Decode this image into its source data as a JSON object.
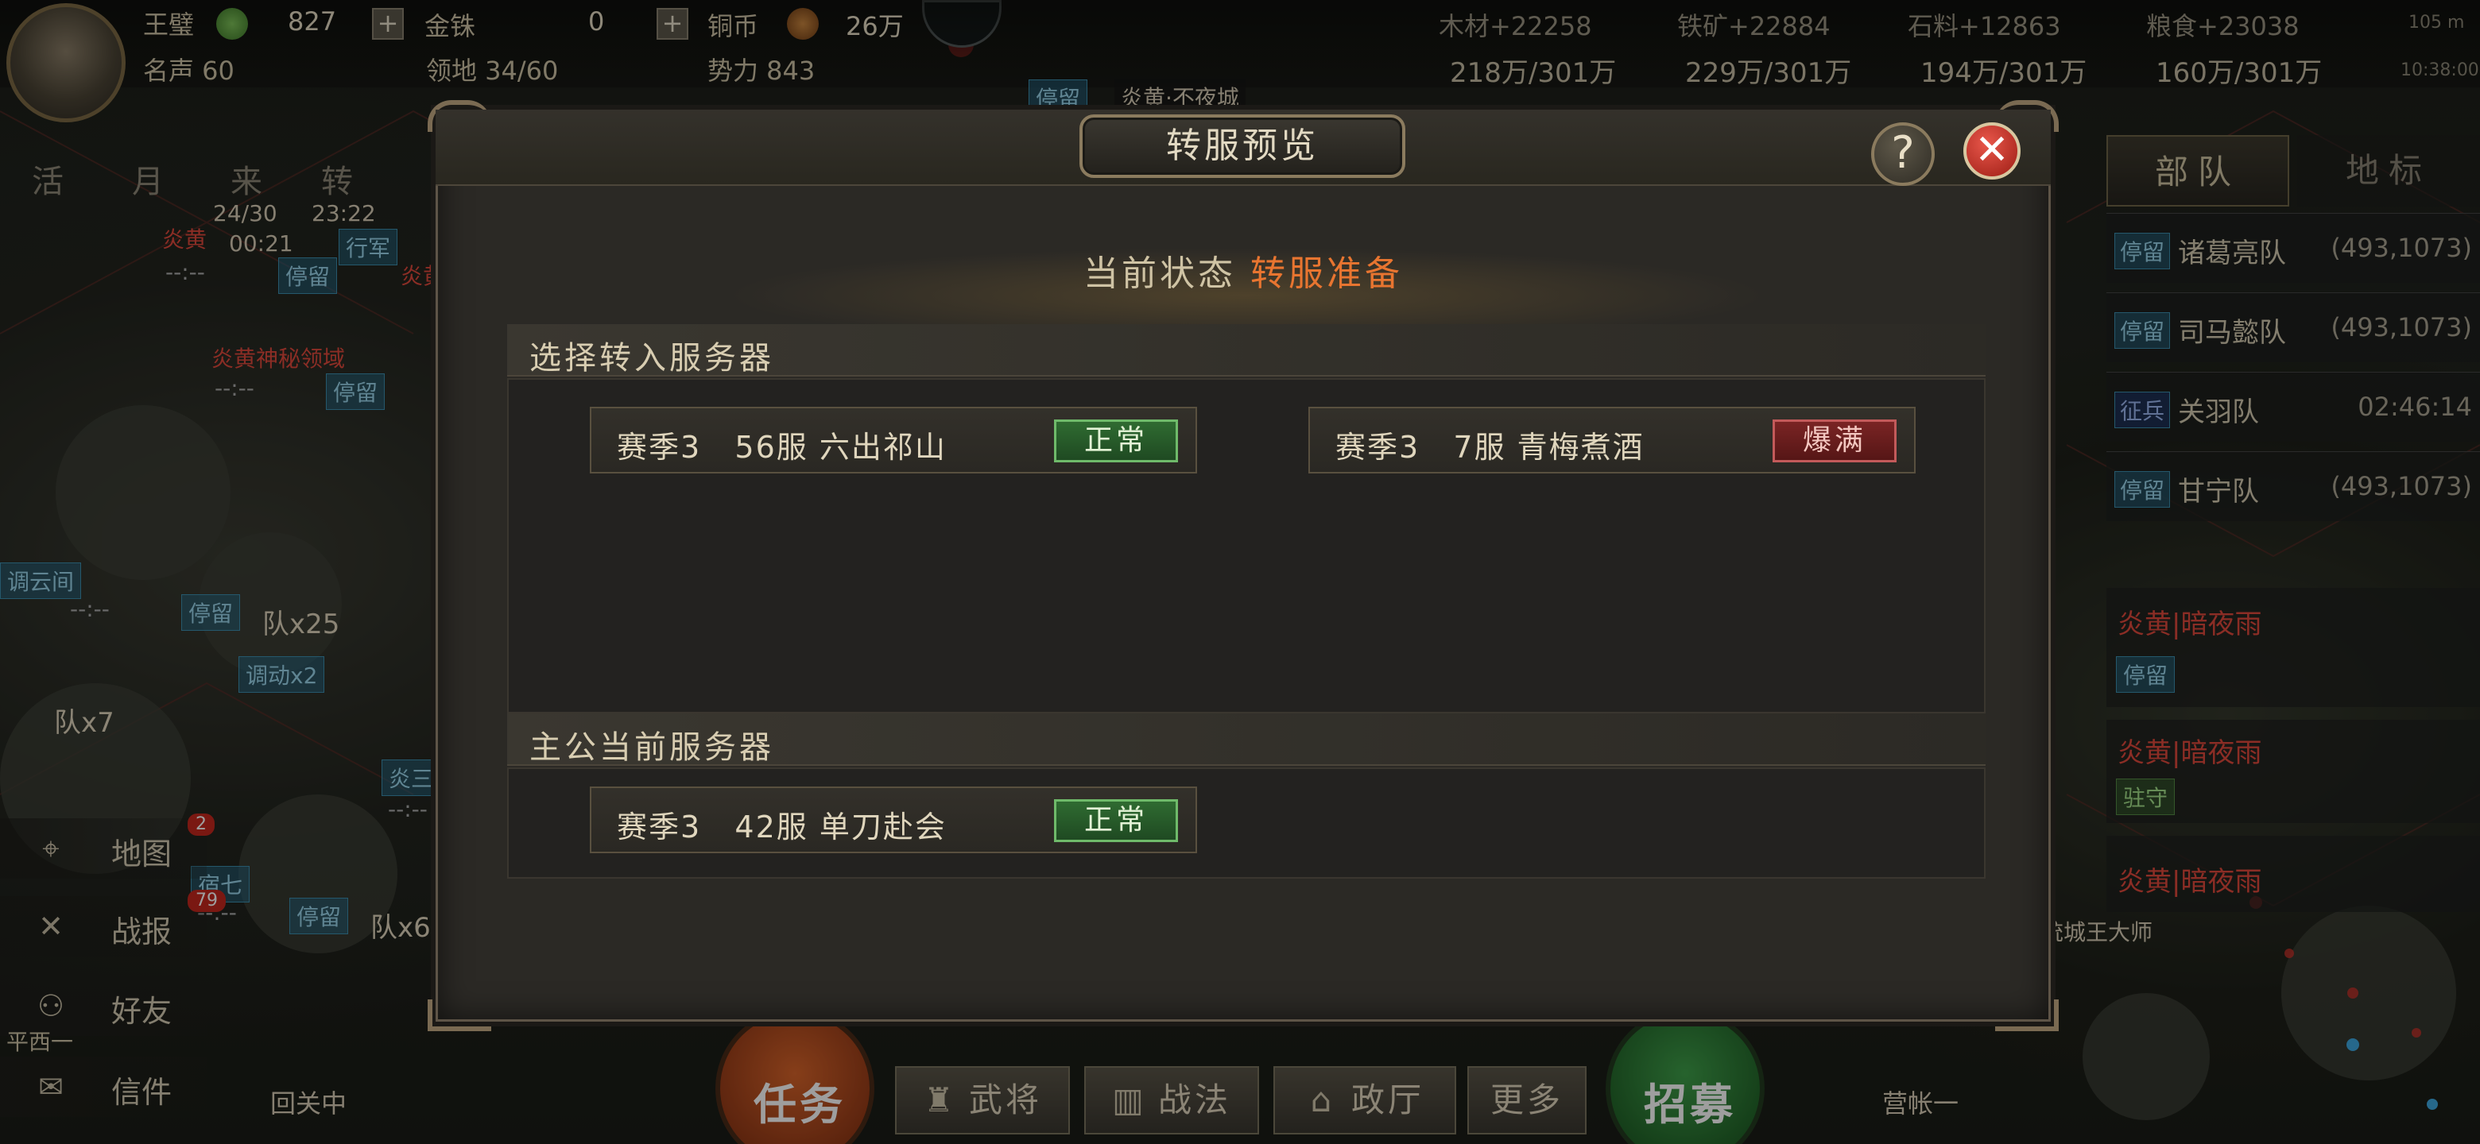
{
  "player": {
    "name": "王璧",
    "gold_value": "827",
    "jinzhu_label": "金铢",
    "jinzhu_value": "0",
    "copper_label": "铜币",
    "copper_value": "26万",
    "fame_label": "名声 60",
    "territory_label": "领地 34/60",
    "power_label": "势力 843"
  },
  "resources": {
    "wood": "木材+22258",
    "iron": "铁矿+22884",
    "stone": "石料+12863",
    "grain": "粮食+23038",
    "wood_cap": "218万/301万",
    "iron_cap": "229万/301万",
    "stone_cap": "194万/301万",
    "grain_cap": "160万/301万",
    "signal": "105 m",
    "time": "10:38:00"
  },
  "left_panel": {
    "top_icons": [
      "活",
      "月",
      "来",
      "转"
    ],
    "army1": {
      "count": "24/30",
      "timer": "23:22",
      "name": "炎黄",
      "clock": "00:21",
      "status": "行军"
    },
    "army2": {
      "name": "炎黄",
      "status": "停留",
      "time": "--:--"
    },
    "domain": {
      "name": "炎黄神秘领域",
      "time": "--:--",
      "status": "停留"
    },
    "cloud": {
      "name": "调云间",
      "time": "--:--",
      "status": "停留",
      "troops": "队x25"
    },
    "move": {
      "label": "调动x2",
      "troops": "队x7"
    },
    "army3": {
      "name": "炎三",
      "time": "--:--"
    },
    "army4": {
      "name": "宿七",
      "time": "--:--",
      "status": "停留",
      "troops": "队x6"
    },
    "buttons": [
      {
        "label": "地图",
        "badge": "2"
      },
      {
        "label": "战报",
        "badge": "79"
      },
      {
        "label": "好友",
        "badge": ""
      },
      {
        "label": "信件",
        "badge": ""
      }
    ],
    "return_label": "回关中",
    "plain_label": "平西一"
  },
  "right_panel": {
    "tab_troops": "部队",
    "tab_landmark": "地标",
    "troops": [
      {
        "status": "停留",
        "name": "诸葛亮队",
        "coord": "(493,1073)"
      },
      {
        "status": "停留",
        "name": "司马懿队",
        "coord": "(493,1073)"
      },
      {
        "status": "征兵",
        "name": "关羽队",
        "coord": "02:46:14"
      },
      {
        "status": "停留",
        "name": "甘宁队",
        "coord": "(493,1073)"
      }
    ],
    "events": [
      {
        "title": "炎黄|暗夜雨",
        "status": "停留"
      },
      {
        "title": "炎黄|暗夜雨",
        "status": "驻守"
      },
      {
        "title": "炎黄|暗夜雨",
        "status": ""
      }
    ],
    "city_label": "统城王大师"
  },
  "map": {
    "banner1": "炎黄·不夜城",
    "stay_tag": "停留"
  },
  "bottom_bar": {
    "task": "任务",
    "generals": "武将",
    "tactics": "战法",
    "government": "政厅",
    "more": "更多",
    "recruit": "招募",
    "camp": "营帐一"
  },
  "dialog": {
    "title": "转服预览",
    "help": "?",
    "status_label": "当前状态",
    "status_value": "转服准备",
    "target_section": "选择转入服务器",
    "current_section": "主公当前服务器",
    "targets": [
      {
        "name": "赛季3   56服 六出祁山",
        "state": "正常",
        "state_type": "normal"
      },
      {
        "name": "赛季3   7服 青梅煮酒",
        "state": "爆满",
        "state_type": "full"
      }
    ],
    "current": {
      "name": "赛季3   42服 单刀赴会",
      "state": "正常",
      "state_type": "normal"
    }
  },
  "colors": {
    "accent_orange": "#e87530",
    "normal_green": "#2f6b31",
    "full_red": "#7a2424",
    "close_red": "#d8392d"
  }
}
